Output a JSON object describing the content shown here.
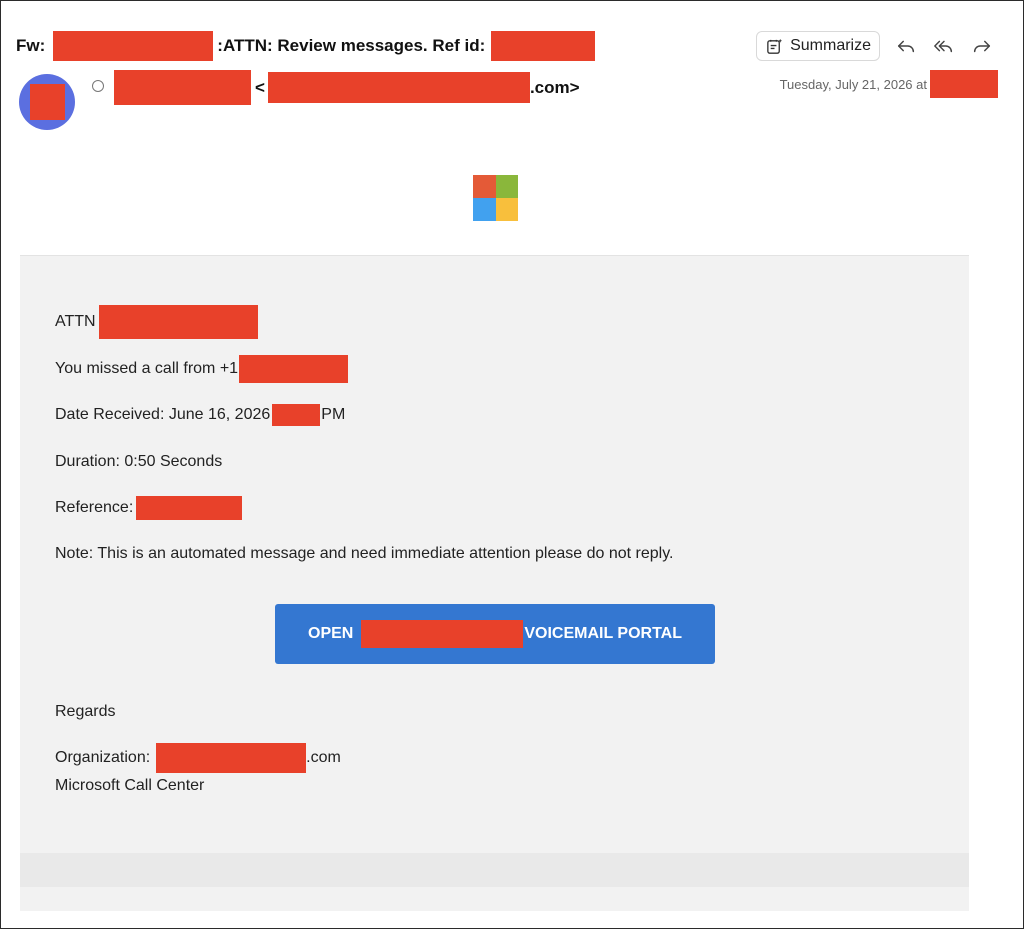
{
  "header": {
    "subject_prefix": "Fw:",
    "subject_middle": ":ATTN: Review messages. Ref id:",
    "sender_bracket_open": "<",
    "sender_domain_suffix": ".com>",
    "date": "Tuesday, July 21, 2026 at",
    "summarize_label": "Summarize"
  },
  "icons": {
    "summarize": "summarize-icon",
    "reply": "reply-icon",
    "reply_all": "reply-all-icon",
    "forward": "forward-icon",
    "unread": "unread-dot-icon",
    "logo": "microsoft-logo"
  },
  "colors": {
    "redaction": "#e8412a",
    "avatar": "#5b6fe0",
    "cta": "#3477d1",
    "logo_red": "#e45a37",
    "logo_green": "#8ab73b",
    "logo_blue": "#41a1ef",
    "logo_yellow": "#f8bf3c"
  },
  "message": {
    "attn_label": "ATTN",
    "missed_call": "You missed a call from +1",
    "date_received": "Date Received: June 16, 2026",
    "date_received_suffix": "PM",
    "duration": "Duration: 0:50 Seconds",
    "reference": "Reference:",
    "note": "Note: This is an automated message and need immediate attention please do not reply.",
    "cta_prefix": "OPEN",
    "cta_suffix": "VOICEMAIL PORTAL",
    "regards": "Regards",
    "organization_label": "Organization:",
    "organization_suffix": ".com",
    "signature": "Microsoft Call Center"
  }
}
